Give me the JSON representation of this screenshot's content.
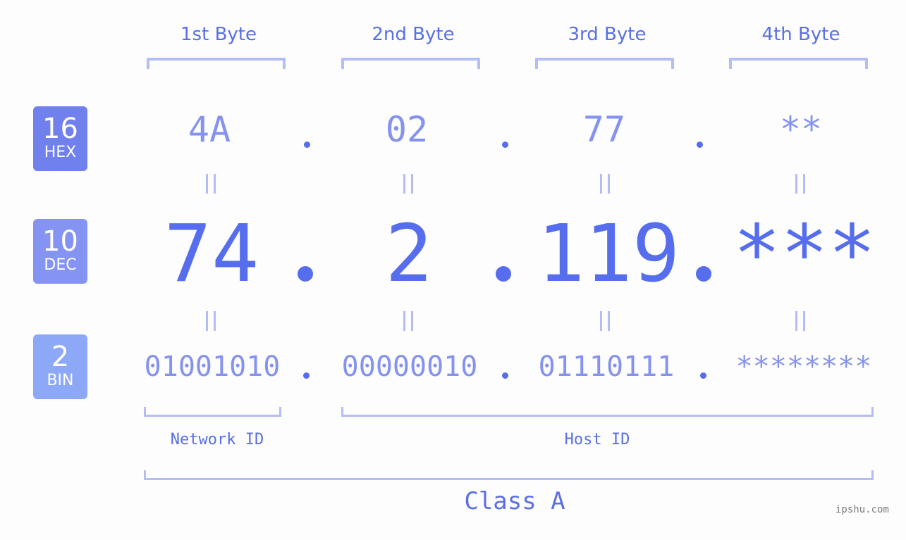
{
  "bytes": {
    "labels": [
      "1st Byte",
      "2nd Byte",
      "3rd Byte",
      "4th Byte"
    ]
  },
  "bases": [
    {
      "number": "16",
      "name": "HEX",
      "color": "#7080ec"
    },
    {
      "number": "10",
      "name": "DEC",
      "color": "#8594f2"
    },
    {
      "number": "2",
      "name": "BIN",
      "color": "#8ea8f8"
    }
  ],
  "ip": {
    "hex": [
      "4A",
      "02",
      "77",
      "**"
    ],
    "dec": [
      "74",
      "2",
      "119",
      "***"
    ],
    "bin": [
      "01001010",
      "00000010",
      "01110111",
      "********"
    ]
  },
  "ids": {
    "network": "Network ID",
    "host": "Host ID"
  },
  "ip_class": "Class A",
  "colors": {
    "accent": "#566ded",
    "light": "#8592ef",
    "bracket": "#b3bdf6"
  },
  "watermark": "ipshu.com"
}
